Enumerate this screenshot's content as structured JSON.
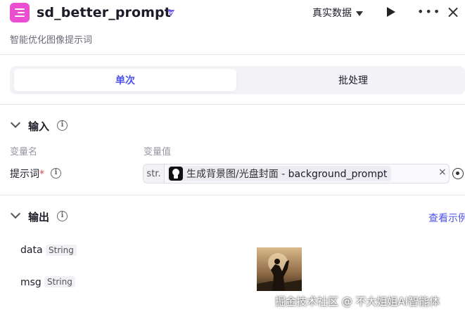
{
  "header": {
    "app_name": "sd_better_prompt",
    "data_select_label": "真实数据",
    "subtitle": "智能优化图像提示词"
  },
  "tabs": [
    {
      "label": "单次",
      "active": true
    },
    {
      "label": "批处理",
      "active": false
    }
  ],
  "input_section": {
    "title": "输入",
    "col_name_header": "变量名",
    "col_value_header": "变量值",
    "param": {
      "name": "提示词",
      "required_mark": "*",
      "type_tag": "str.",
      "ref_node": "生成背景图/光盘封面",
      "ref_separator": " - ",
      "ref_variable": "background_prompt",
      "clear_symbol": "×"
    }
  },
  "output_section": {
    "title": "输出",
    "view_example_label": "查看示例",
    "fields": [
      {
        "name": "data",
        "type": "String"
      },
      {
        "name": "msg",
        "type": "String"
      }
    ]
  },
  "watermark": "掘金技术社区 @ 不大姐姐AI智能体",
  "colors": {
    "accent": "#4d53e8",
    "app_icon": "#e94fd0",
    "required": "#e5484d"
  },
  "icons": [
    "app-icon",
    "verified-badge-icon",
    "caret-down-icon",
    "play-icon",
    "more-icon",
    "close-icon",
    "chevron-down-icon",
    "info-icon",
    "bot-avatar-icon",
    "target-icon"
  ]
}
